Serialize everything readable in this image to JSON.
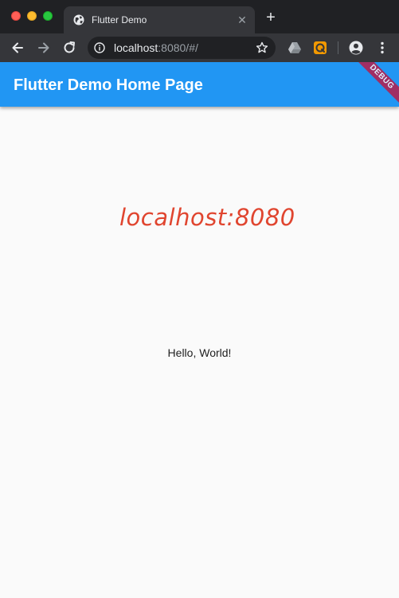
{
  "browser": {
    "tab": {
      "title": "Flutter Demo",
      "close_glyph": "✕",
      "favicon": "globe-icon"
    },
    "new_tab_glyph": "+",
    "address": {
      "host": "localhost",
      "rest": ":8080/#/"
    },
    "icons": {
      "back": "arrow-left-icon",
      "forward": "arrow-right-icon",
      "reload": "reload-icon",
      "info": "info-icon",
      "star": "star-icon",
      "drive": "google-drive-icon",
      "extension": "orange-extension-icon",
      "profile": "profile-icon",
      "menu": "more-vertical-icon"
    },
    "colors": {
      "frame": "#202124",
      "toolbar": "#35363a",
      "text": "#e8eaed",
      "muted": "#9aa0a6"
    }
  },
  "app": {
    "title": "Flutter Demo Home Page",
    "debug_banner": "DEBUG",
    "watermark": "localhost:8080",
    "body_text": "Hello, World!",
    "colors": {
      "appbar": "#2196f3",
      "background": "#fafafa",
      "watermark": "#e0452f",
      "debug_banner": "#b71c4a"
    }
  }
}
